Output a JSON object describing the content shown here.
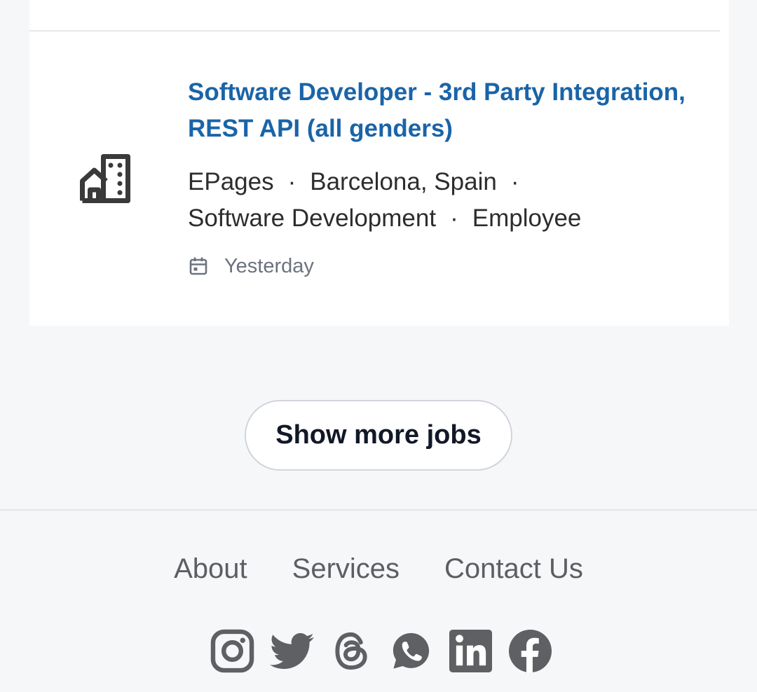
{
  "job": {
    "title": "Software Developer - 3rd Party Integration, REST API (all genders)",
    "company": "EPages",
    "location": "Barcelona, Spain",
    "category": "Software Development",
    "employment_type": "Employee",
    "separator": "·",
    "posted": "Yesterday",
    "icon": "building-icon",
    "date_icon": "calendar-icon"
  },
  "actions": {
    "show_more_label": "Show more jobs"
  },
  "footer": {
    "links": [
      "About",
      "Services",
      "Contact Us"
    ],
    "social_icons": [
      "instagram-icon",
      "twitter-icon",
      "threads-icon",
      "whatsapp-icon",
      "linkedin-icon",
      "facebook-icon"
    ]
  },
  "colors": {
    "title": "#1a64a8",
    "icon": "#3a3a3a",
    "social": "#5f6063",
    "background": "#f6f7f9"
  }
}
